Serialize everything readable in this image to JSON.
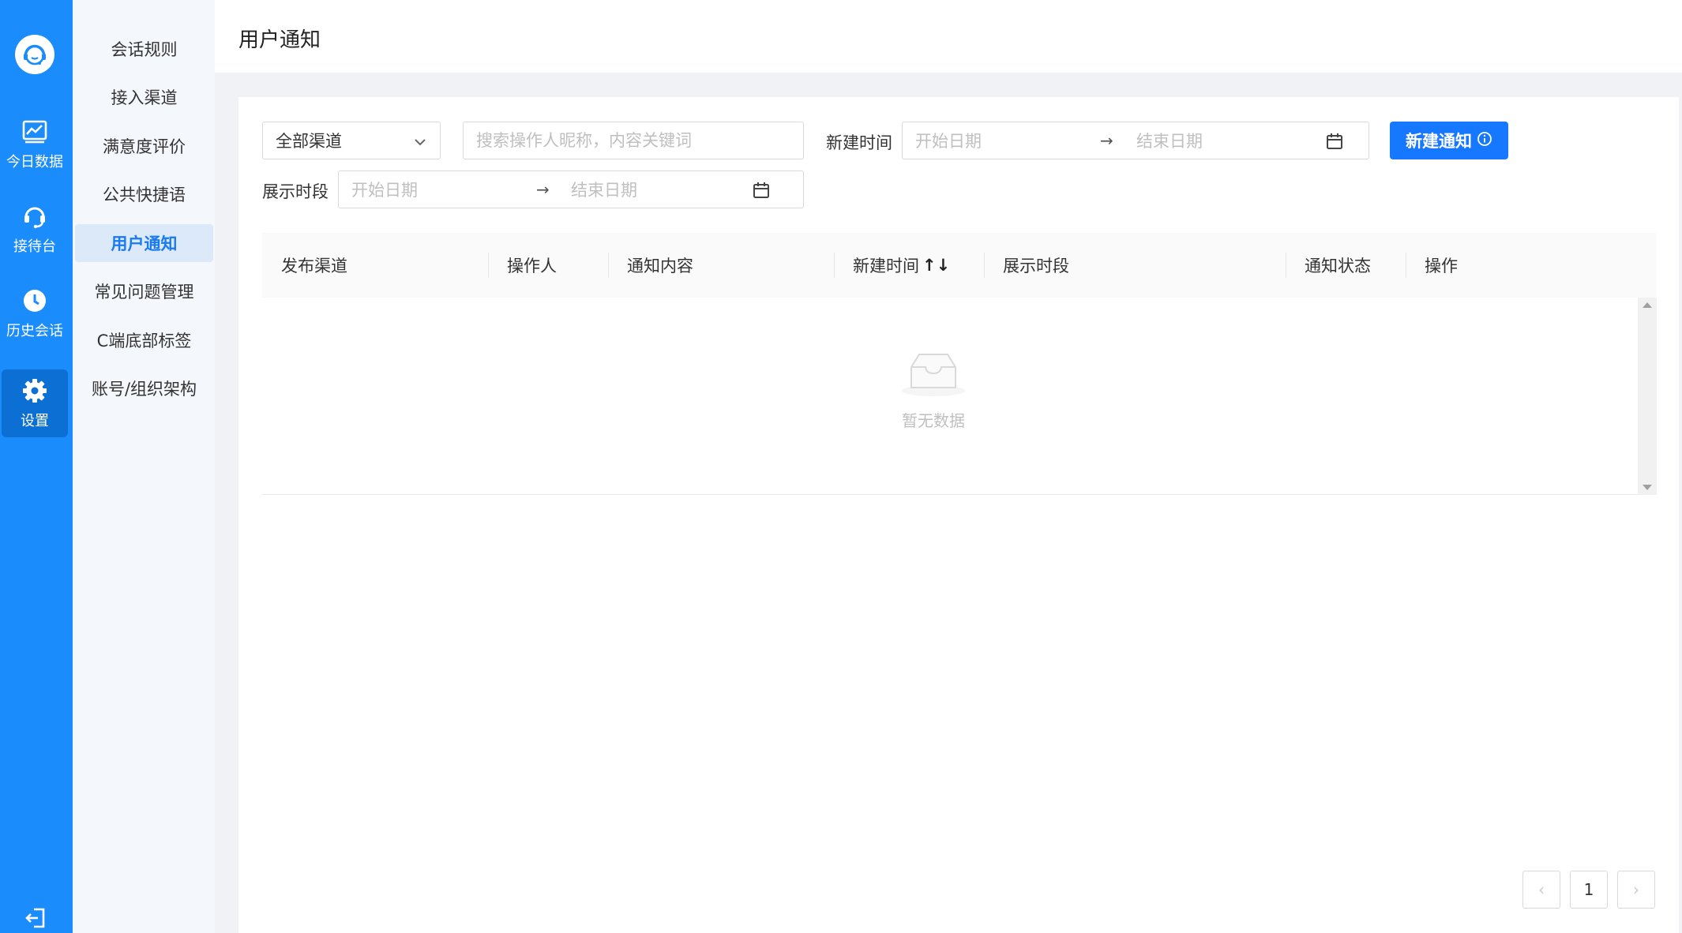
{
  "rail": {
    "items": [
      {
        "label": "今日数据",
        "icon": "chart-line-icon"
      },
      {
        "label": "接待台",
        "icon": "headset-icon"
      },
      {
        "label": "历史会话",
        "icon": "clock-icon"
      },
      {
        "label": "设置",
        "icon": "gear-icon",
        "active": true
      }
    ]
  },
  "menu": {
    "items": [
      {
        "label": "会话规则"
      },
      {
        "label": "接入渠道"
      },
      {
        "label": "满意度评价"
      },
      {
        "label": "公共快捷语"
      },
      {
        "label": "用户通知",
        "active": true
      },
      {
        "label": "常见问题管理"
      },
      {
        "label": "C端底部标签"
      },
      {
        "label": "账号/组织架构"
      }
    ]
  },
  "header": {
    "title": "用户通知"
  },
  "filters": {
    "channel_select": "全部渠道",
    "search_placeholder": "搜索操作人昵称，内容关键词",
    "created_label": "新建时间",
    "display_label": "展示时段",
    "start_placeholder": "开始日期",
    "end_placeholder": "结束日期",
    "range_arrow": "→",
    "new_button": "新建通知"
  },
  "table": {
    "columns": [
      "发布渠道",
      "操作人",
      "通知内容",
      "新建时间",
      "展示时段",
      "通知状态",
      "操作"
    ],
    "sort_icons": "↑↓",
    "empty_text": "暂无数据"
  },
  "pagination": {
    "prev": "‹",
    "current": "1",
    "next": "›"
  },
  "colors": {
    "primary": "#1677ff",
    "rail": "#1a8cfb",
    "menu_active_bg": "#dce9f9"
  }
}
